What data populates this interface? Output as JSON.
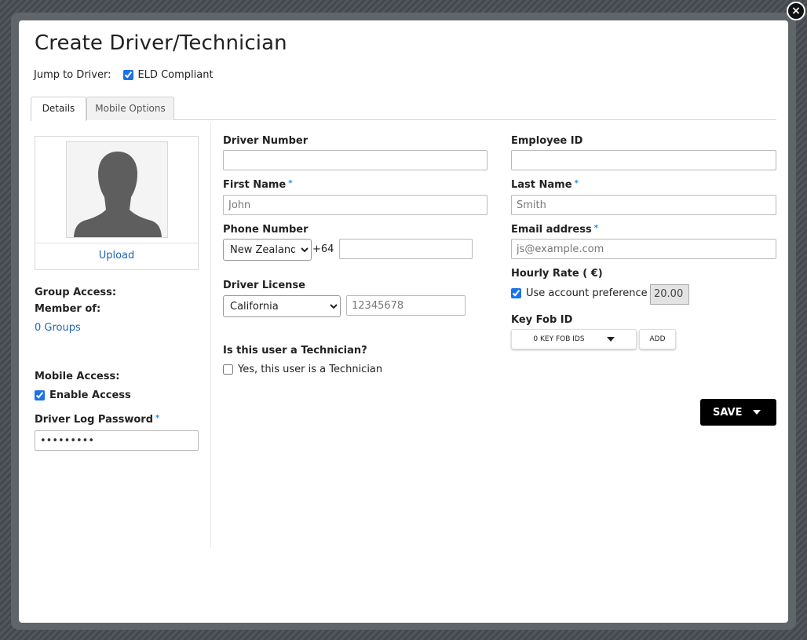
{
  "dialog": {
    "title": "Create Driver/Technician",
    "close_label": "×"
  },
  "jump": {
    "label": "Jump to Driver:",
    "eld_label": "ELD Compliant",
    "eld_checked": true
  },
  "tabs": [
    {
      "label": "Details",
      "active": true
    },
    {
      "label": "Mobile Options",
      "active": false
    }
  ],
  "left": {
    "upload_label": "Upload",
    "group_access_label": "Group Access:",
    "member_of_label": "Member of:",
    "groups_link": "0 Groups",
    "mobile_access_label": "Mobile Access:",
    "enable_access_label": "Enable Access",
    "enable_access_checked": true,
    "password_label": "Driver Log Password",
    "password_value": "•••••••••"
  },
  "form": {
    "required_marker": "*",
    "driver_number_label": "Driver Number",
    "driver_number_value": "",
    "employee_id_label": "Employee ID",
    "employee_id_value": "",
    "first_name_label": "First Name",
    "first_name_placeholder": "John",
    "last_name_label": "Last Name",
    "last_name_placeholder": "Smith",
    "phone_label": "Phone Number",
    "phone_country": "New Zealand",
    "phone_prefix": "+64",
    "phone_value": "",
    "email_label": "Email address",
    "email_placeholder": "js@example.com",
    "hourly_rate_label": "Hourly Rate ( €)",
    "use_account_pref_label": "Use account preference",
    "use_account_pref_checked": true,
    "hourly_rate_value": "20.00",
    "license_label": "Driver License",
    "license_state": "California",
    "license_placeholder": "12345678",
    "key_fob_label": "Key Fob ID",
    "key_fob_dropdown": "0 KEY FOB IDS",
    "key_fob_add": "ADD",
    "technician_question": "Is this user a Technician?",
    "technician_checkbox_label": "Yes, this user is a Technician",
    "technician_checked": false
  },
  "actions": {
    "save_label": "SAVE"
  }
}
